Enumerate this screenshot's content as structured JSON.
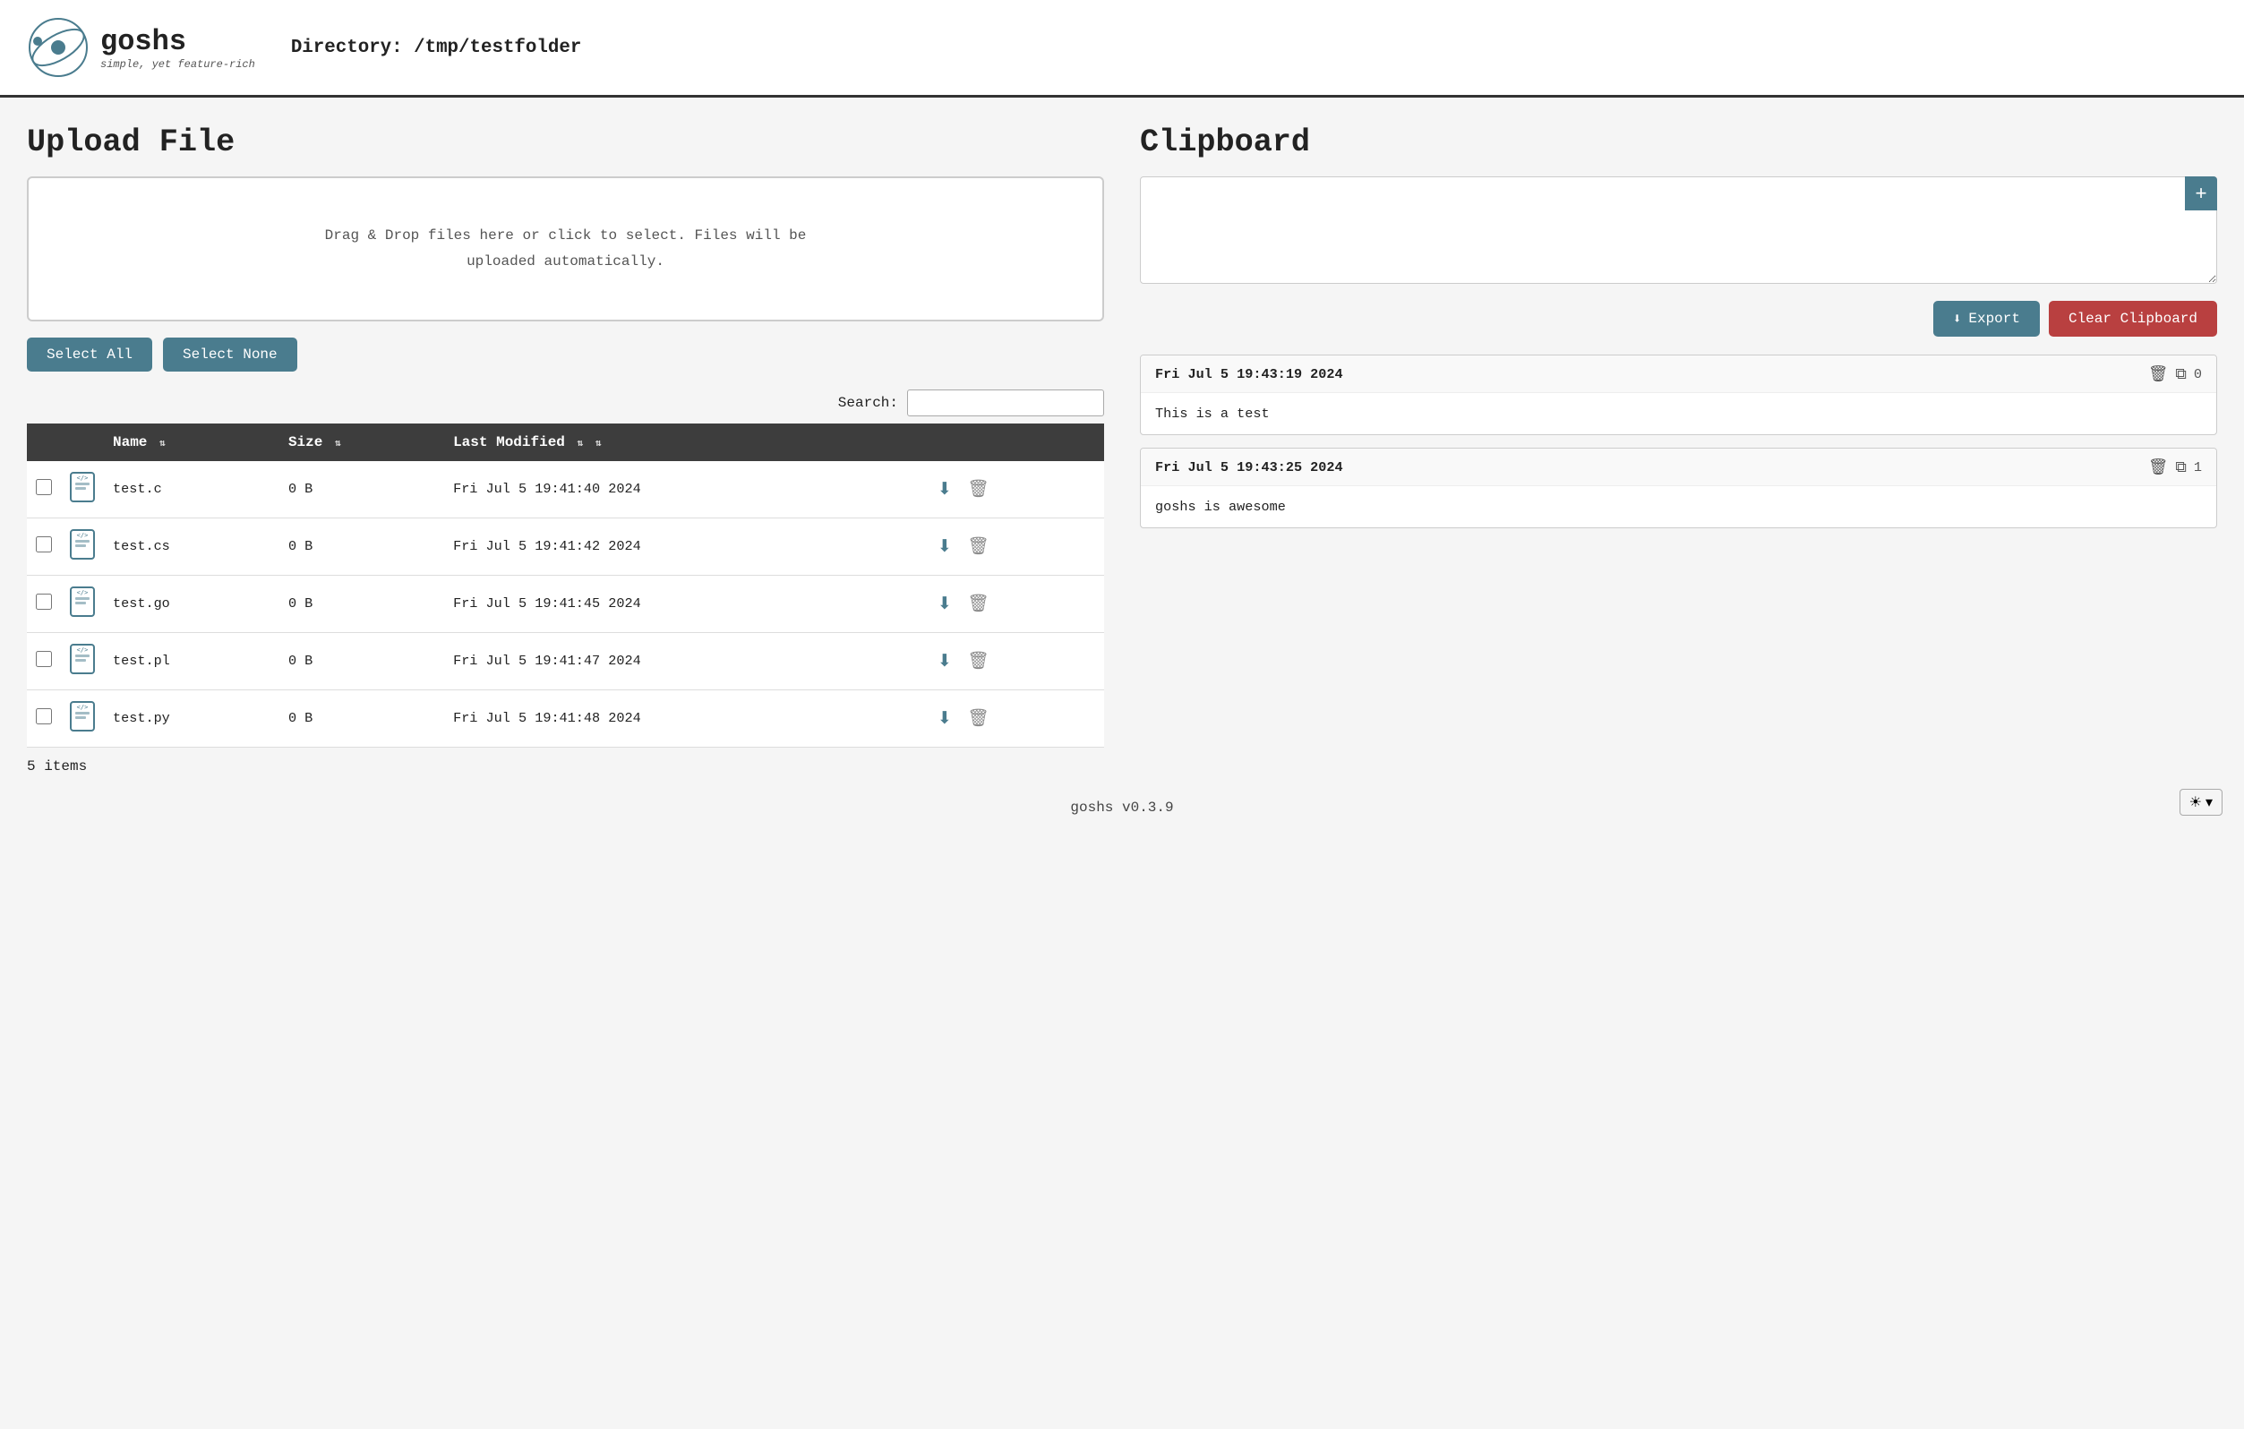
{
  "header": {
    "logo_title": "goshs",
    "logo_subtitle": "simple, yet feature-rich",
    "directory_label": "Directory: /tmp/testfolder"
  },
  "upload": {
    "title": "Upload File",
    "dropzone_text": "Drag & Drop files here or click to select. Files will be\nuploaded automatically.",
    "select_all_label": "Select All",
    "select_none_label": "Select None",
    "search_label": "Search:",
    "search_placeholder": ""
  },
  "table": {
    "columns": [
      {
        "label": "Name",
        "sort": true
      },
      {
        "label": "Size",
        "sort": true
      },
      {
        "label": "Last Modified",
        "sort": true
      }
    ],
    "rows": [
      {
        "name": "test.c",
        "size": "0 B",
        "modified": "Fri Jul 5 19:41:40 2024"
      },
      {
        "name": "test.cs",
        "size": "0 B",
        "modified": "Fri Jul 5 19:41:42 2024"
      },
      {
        "name": "test.go",
        "size": "0 B",
        "modified": "Fri Jul 5 19:41:45 2024"
      },
      {
        "name": "test.pl",
        "size": "0 B",
        "modified": "Fri Jul 5 19:41:47 2024"
      },
      {
        "name": "test.py",
        "size": "0 B",
        "modified": "Fri Jul 5 19:41:48 2024"
      }
    ],
    "items_count": "5 items"
  },
  "clipboard": {
    "title": "Clipboard",
    "textarea_placeholder": "",
    "expand_btn": "+",
    "export_label": "Export",
    "clear_label": "Clear Clipboard",
    "entries": [
      {
        "timestamp": "Fri Jul 5 19:43:19 2024",
        "number": "0",
        "body": "This is a test"
      },
      {
        "timestamp": "Fri Jul 5 19:43:25 2024",
        "number": "1",
        "body": "goshs is awesome"
      }
    ]
  },
  "footer": {
    "version": "goshs v0.3.9"
  }
}
